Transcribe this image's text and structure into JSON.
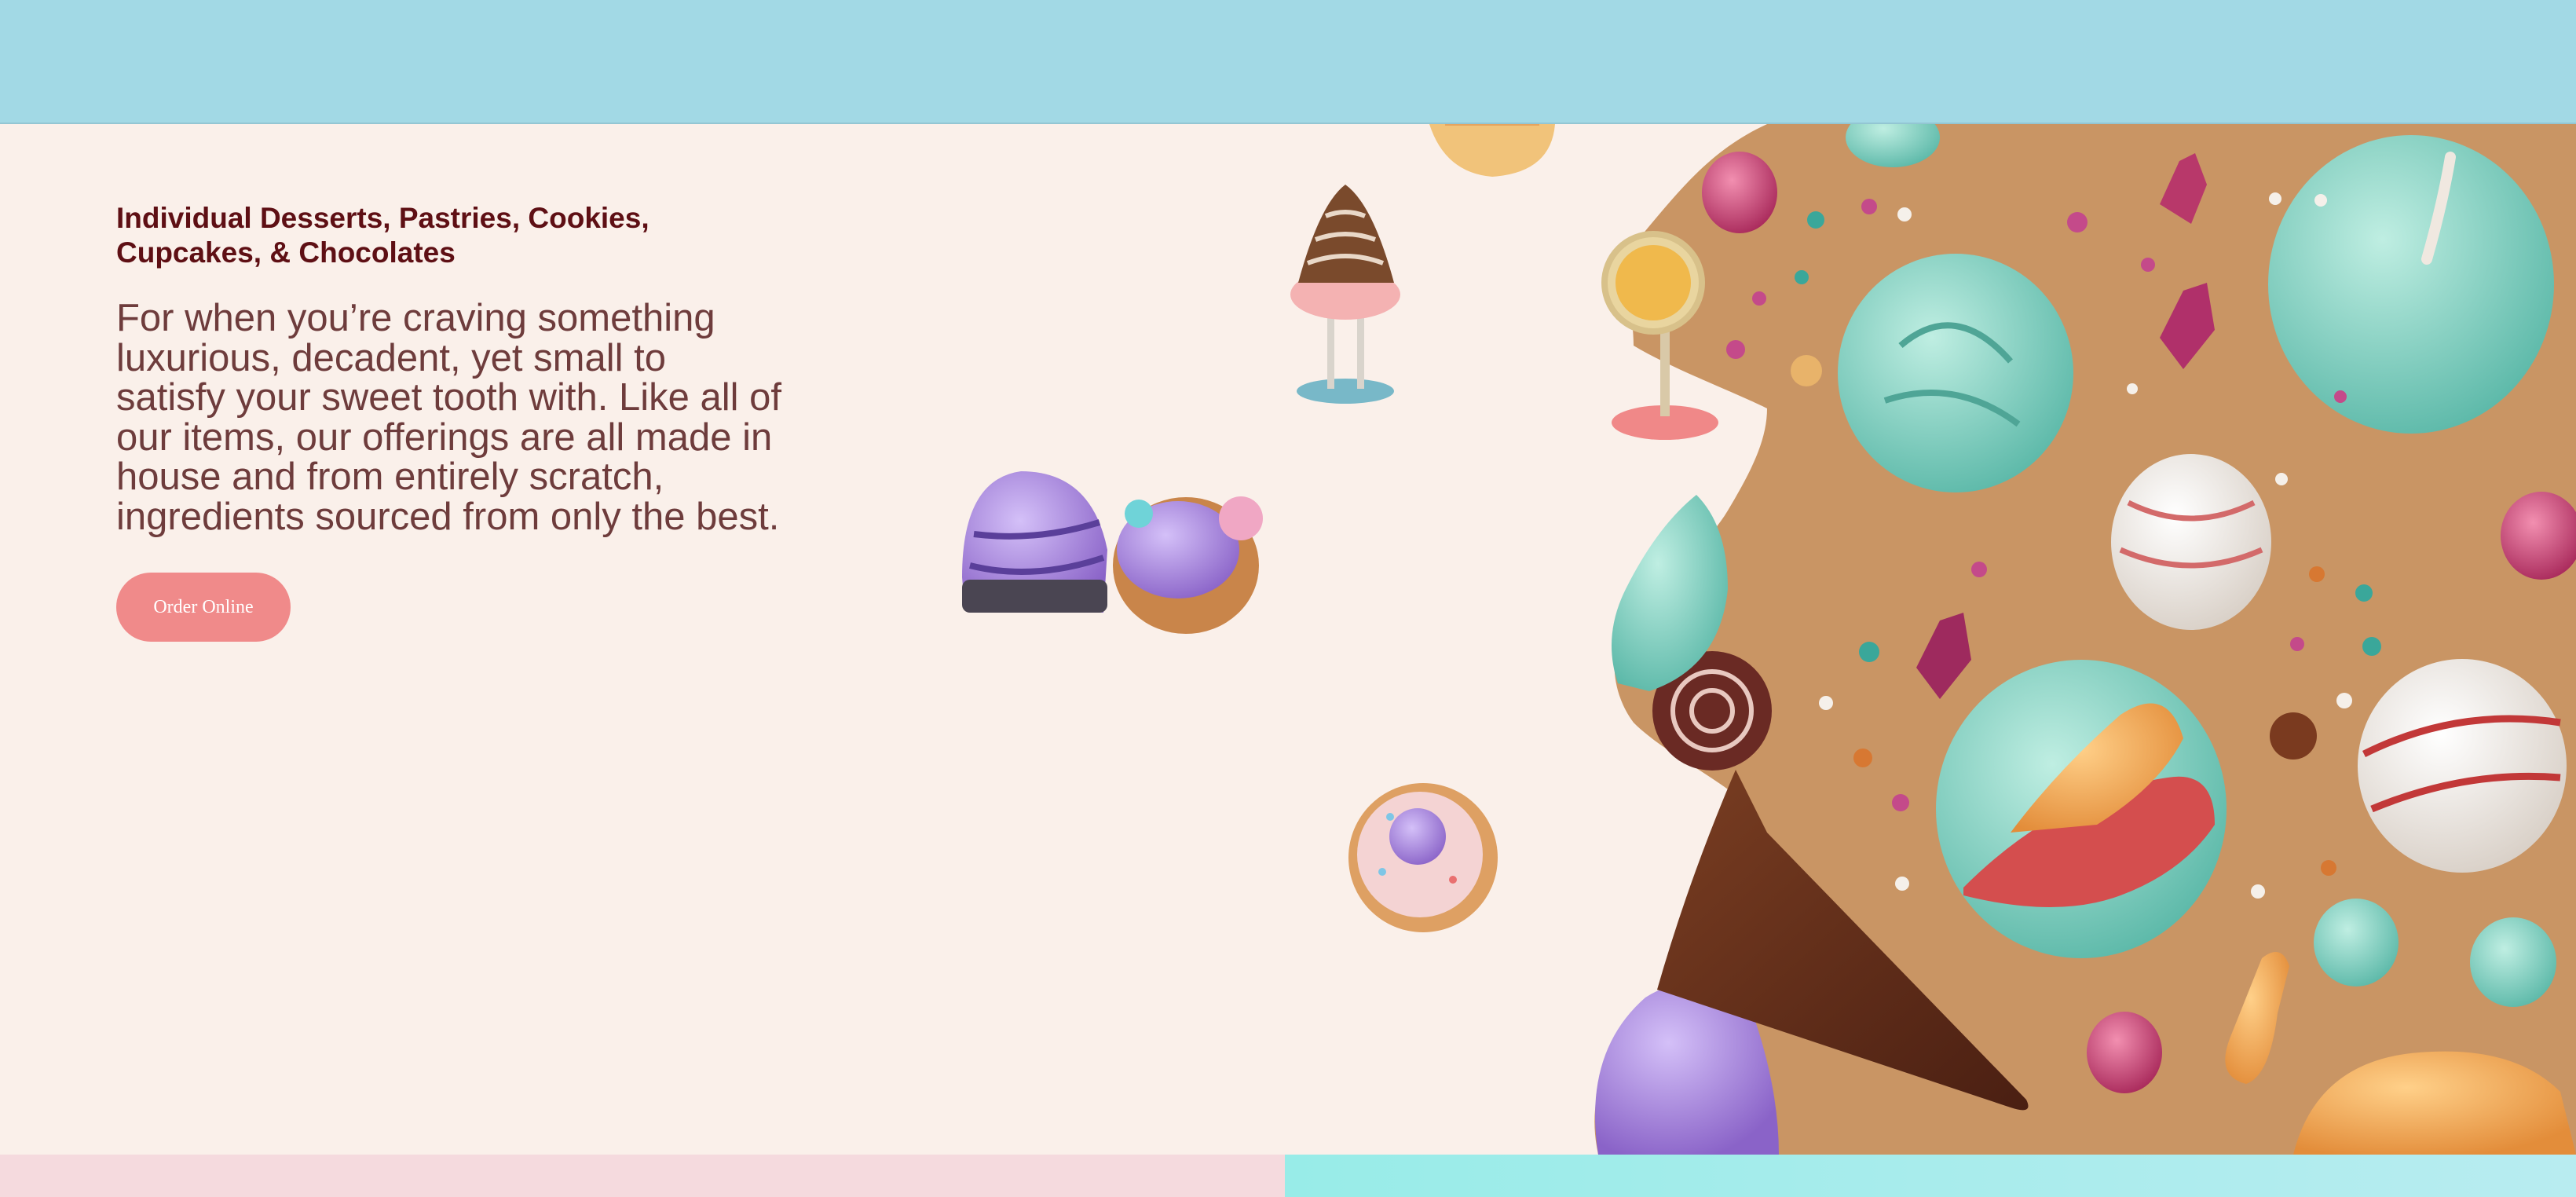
{
  "hero": {
    "heading": "Individual Desserts, Pastries, Cookies, Cupcakes, & Chocolates",
    "description": "For when you’re craving something luxurious, decadent, yet small to satisfy your sweet tooth with. Like all of our items, our offerings are all made in house and from entirely scratch, ingredients sourced from only the best.",
    "order_button_label": "Order Online"
  },
  "colors": {
    "top_bar": "#a2d9e5",
    "hero_background": "#faf0ea",
    "heading": "#5e0f14",
    "body_text": "#6e3c3c",
    "button": "#f08a8a",
    "bottom_left_band": "#f5dade",
    "bottom_right_band": "#98ece8",
    "art_background": "#c99564"
  },
  "images": {
    "hero_art": "dessert-collage-illustration"
  }
}
